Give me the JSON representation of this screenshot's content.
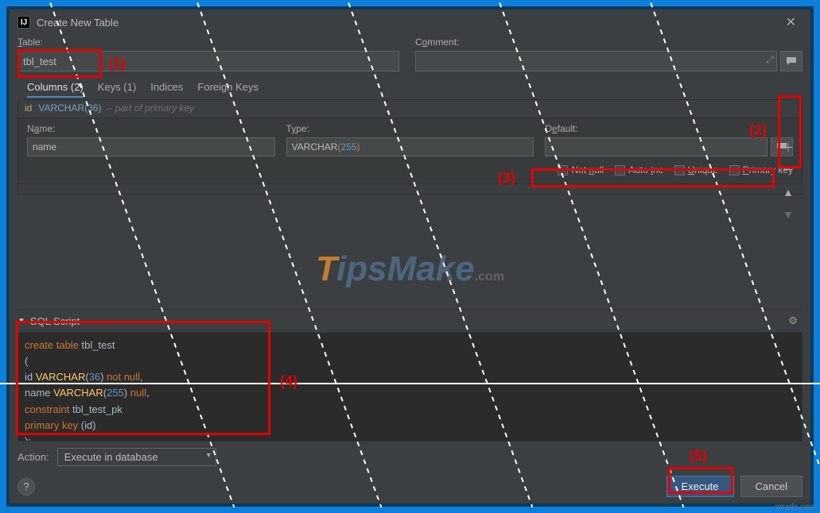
{
  "titlebar": {
    "title": "Create New Table"
  },
  "labels": {
    "table": "Table:",
    "comment": "Comment:",
    "name": "Name:",
    "type": "Type:",
    "default": "Default:",
    "notnull": "Not null",
    "autoinc": "Auto inc",
    "unique": "Unique",
    "primarykey": "Primary key",
    "sql_script": "SQL Script",
    "action": "Action:"
  },
  "inputs": {
    "table_name": "tbl_test",
    "col_name": "name",
    "col_type_base": "VARCHAR",
    "col_type_len": "255",
    "default_val": ""
  },
  "tabs": {
    "columns": "Columns (2)",
    "keys": "Keys (1)",
    "indices": "Indices",
    "foreign": "Foreign Keys"
  },
  "listing": {
    "col": "id",
    "type": "VARCHAR(36)",
    "note": "-- part of primary key"
  },
  "dropdown": {
    "action_value": "Execute in database"
  },
  "buttons": {
    "execute": "Execute",
    "cancel": "Cancel"
  },
  "sql": {
    "l1a": "create table",
    "l1b": " tbl_test",
    "l2": "(",
    "l3a": "    id ",
    "l3b": "VARCHAR",
    "l3n": "36",
    "l3c": " not null",
    "l4a": "    name ",
    "l4b": "VARCHAR",
    "l4n": "255",
    "l4c": " null",
    "l5a": "    constraint",
    "l5b": " tbl_test_pk",
    "l6a": "        primary key",
    "l6b": " (id)",
    "l7": ");"
  },
  "annotations": {
    "a1": "(1)",
    "a2": "(2)",
    "a3": "(3)",
    "a4": "(4)",
    "a5": "(5)"
  },
  "attribution": "wsxdn.com"
}
